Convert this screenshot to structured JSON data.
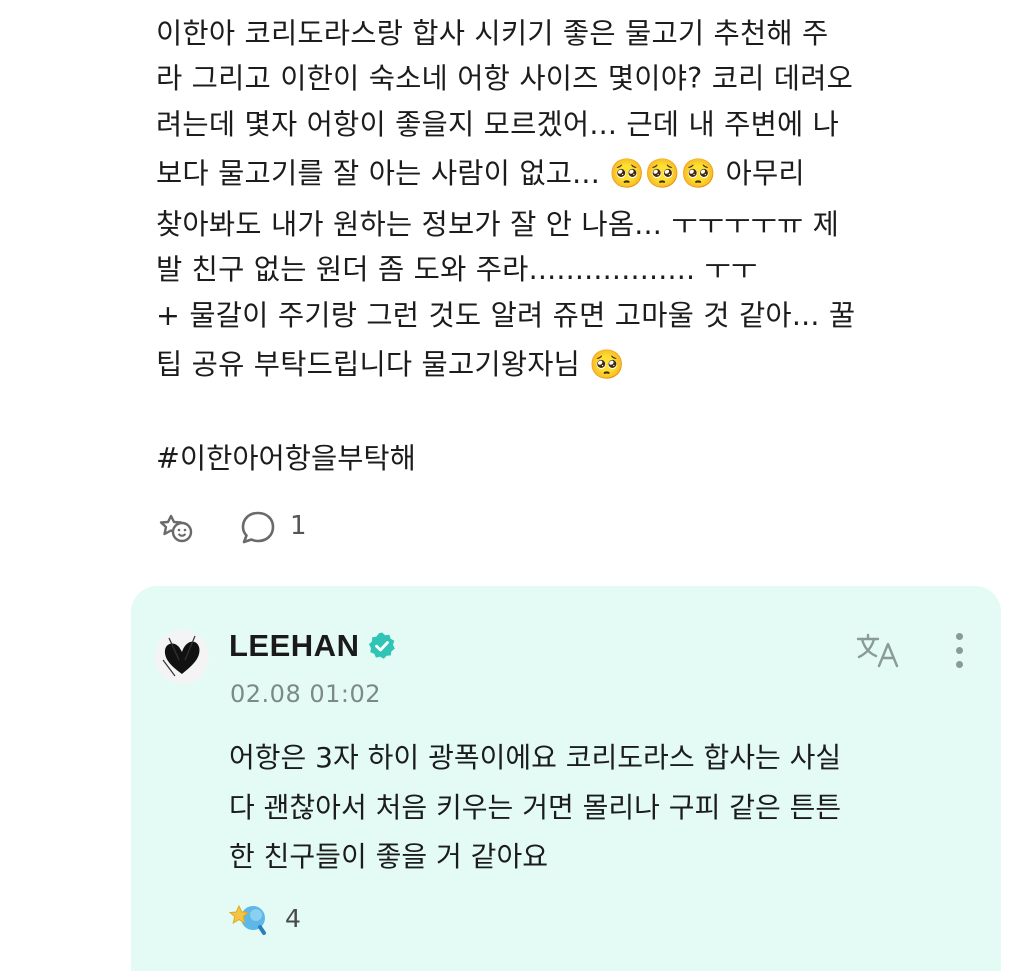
{
  "post": {
    "lines": [
      "이한아 코리도라스랑 합사 시키기 좋은 물고기 추천해 주",
      "라 그리고 이한이 숙소네 어항 사이즈 몇이야? 코리 데려오",
      "려는데 몇자 어항이 좋을지 모르겠어... 근데 내 주변에 나",
      "보다 물고기를 잘 아는 사람이 없고... 🥺🥺🥺 아무리",
      "찾아봐도 내가 원하는 정보가 잘 안 나옴... ㅜㅜㅜㅜㅠ 제",
      "발 친구 없는 원더 좀 도와 주라.................. ㅜㅜ",
      "+ 물갈이 주기랑 그런 것도 알려 쥬면 고마울 것 같아... 꿀",
      "팁 공유 부탁드립니다 물고기왕자님 🥺"
    ],
    "hashtag": "#이한아어항을부탁해",
    "comment_count": "1"
  },
  "reply": {
    "username": "LEEHAN",
    "timestamp": "02.08 01:02",
    "lines": [
      "어항은 3자 하이 광폭이에요 코리도라스 합사는 사실",
      "다 괜찮아서 처음 키우는 거면 몰리나 구피 같은 튼튼",
      "한 친구들이 좋을 거 같아요"
    ],
    "like_count": "4"
  },
  "icons": {
    "reaction": "add-reaction-icon",
    "comment": "comment-bubble-icon",
    "verified": "verified-badge-icon",
    "translate": "translate-icon",
    "more": "more-vertical-icon",
    "like": "sparkle-reaction-icon"
  },
  "colors": {
    "card_background": "#e3fbf4",
    "verified": "#2fc4b6",
    "timestamp": "#7c8a87"
  }
}
